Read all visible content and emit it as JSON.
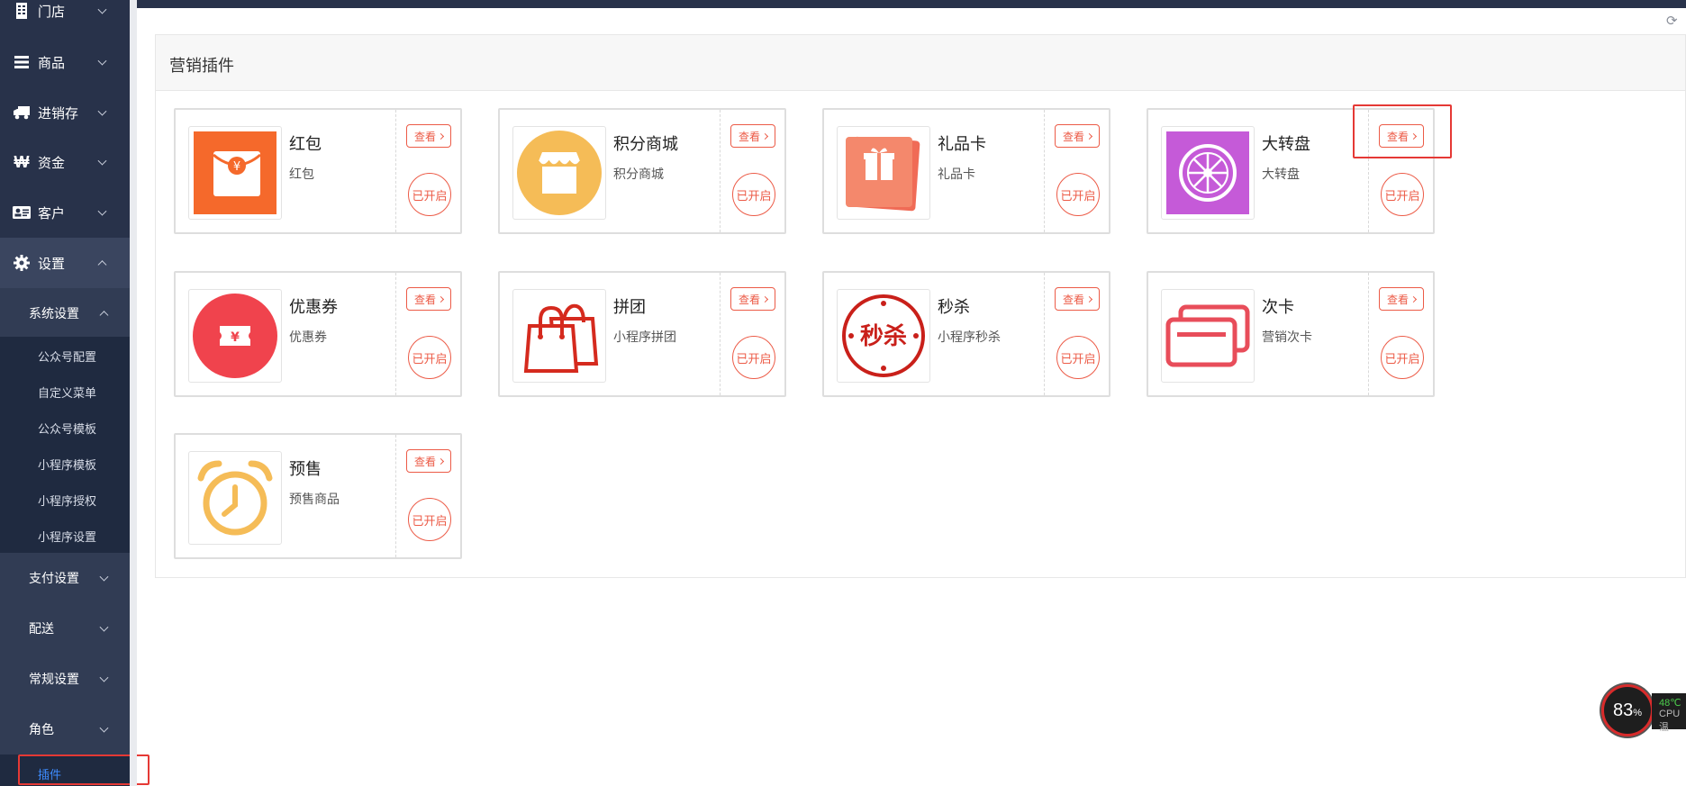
{
  "sidebar": {
    "menu": [
      {
        "label": "门店",
        "icon": "store-icon"
      },
      {
        "label": "商品",
        "icon": "list-icon"
      },
      {
        "label": "进销存",
        "icon": "truck-icon"
      },
      {
        "label": "资金",
        "icon": "won-icon"
      },
      {
        "label": "客户",
        "icon": "id-card-icon"
      },
      {
        "label": "设置",
        "icon": "gear-icon"
      }
    ],
    "system_settings": "系统设置",
    "system_items": [
      "公众号配置",
      "自定义菜单",
      "公众号模板",
      "小程序模板",
      "小程序授权",
      "小程序设置"
    ],
    "sub_groups": [
      "支付设置",
      "配送",
      "常规设置",
      "角色"
    ],
    "active_leaf": "插件"
  },
  "panel": {
    "title": "营销插件"
  },
  "plugins": [
    {
      "name": "红包",
      "desc": "红包",
      "view_label": "查看",
      "status": "已开启",
      "icon": "red-envelope-icon"
    },
    {
      "name": "积分商城",
      "desc": "积分商城",
      "view_label": "查看",
      "status": "已开启",
      "icon": "shop-icon"
    },
    {
      "name": "礼品卡",
      "desc": "礼品卡",
      "view_label": "查看",
      "status": "已开启",
      "icon": "gift-card-icon"
    },
    {
      "name": "大转盘",
      "desc": "大转盘",
      "view_label": "查看",
      "status": "已开启",
      "icon": "wheel-icon"
    },
    {
      "name": "优惠券",
      "desc": "优惠券",
      "view_label": "查看",
      "status": "已开启",
      "icon": "coupon-icon"
    },
    {
      "name": "拼团",
      "desc": "小程序拼团",
      "view_label": "查看",
      "status": "已开启",
      "icon": "shopping-bag-icon"
    },
    {
      "name": "秒杀",
      "desc": "小程序秒杀",
      "view_label": "查看",
      "status": "已开启",
      "icon": "flash-sale-icon"
    },
    {
      "name": "次卡",
      "desc": "营销次卡",
      "view_label": "查看",
      "status": "已开启",
      "icon": "cards-icon"
    },
    {
      "name": "预售",
      "desc": "预售商品",
      "view_label": "查看",
      "status": "已开启",
      "icon": "alarm-clock-icon"
    }
  ],
  "cpu_widget": {
    "percent": "83",
    "unit": "%",
    "temp": "48℃",
    "label": "CPU温"
  },
  "colors": {
    "sidebar_bg": "#28324a",
    "accent_red": "#ec5b47",
    "active_link": "#3d8bfd"
  }
}
